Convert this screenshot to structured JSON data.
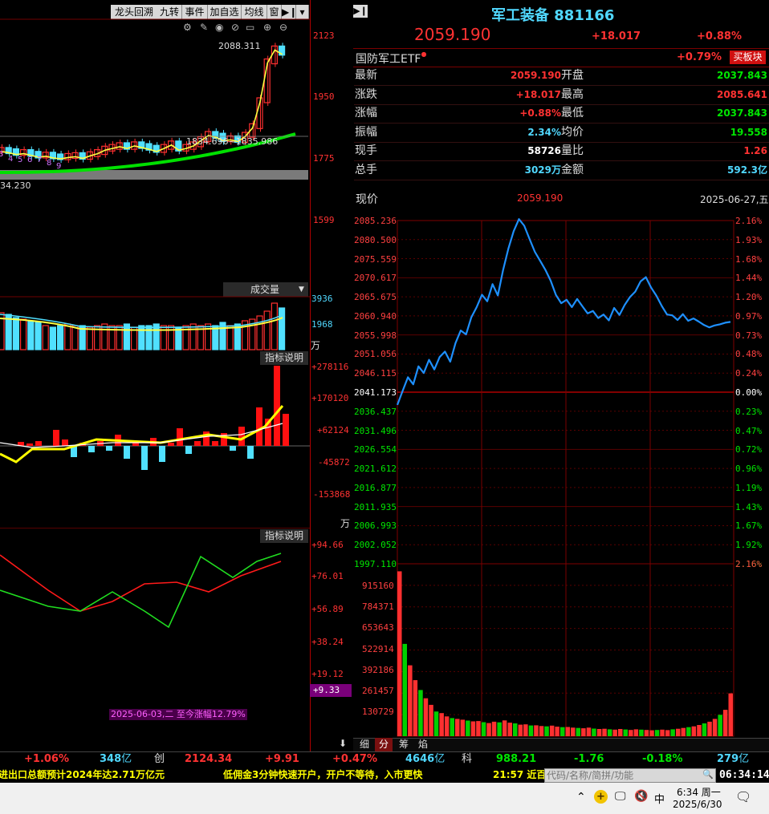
{
  "toolbar_tabs": [
    "龙头回溯",
    "九转",
    "事件",
    "加自选",
    "均线",
    "窗"
  ],
  "kline": {
    "price_ticks": [
      "2123",
      "1950",
      "1775",
      "1599"
    ],
    "high_label": "2088.311",
    "ma_label": "1834.696~1835.986",
    "low_label": "34.230",
    "nine_digits": [
      "3",
      "4",
      "5",
      "6",
      "7",
      "8",
      "9"
    ]
  },
  "volume_panel": {
    "selector": "成交量",
    "ticks": [
      "3936",
      "1968"
    ],
    "unit": "万"
  },
  "macd_panel": {
    "button": "指标说明",
    "ticks": [
      "+278116",
      "+170120",
      "+62124",
      "-45872",
      "-153868"
    ],
    "unit": "万"
  },
  "kdj_panel": {
    "button": "指标说明",
    "ticks": [
      "+94.66",
      "+76.01",
      "+56.89",
      "+38.24",
      "+19.12"
    ],
    "current": "+9.33",
    "footnote": "2025-06-03,二 至今涨幅12.79%"
  },
  "header": {
    "name": "军工装备",
    "code": "881166",
    "price": "2059.190",
    "change": "+18.017",
    "change_pct": "+0.88%"
  },
  "etf": {
    "name": "国防军工ETF",
    "pct": "+0.79%",
    "button": "买板块"
  },
  "stats": [
    {
      "l1": "最新",
      "v1": "2059.190",
      "c1": "red",
      "l2": "开盘",
      "v2": "2037.843",
      "c2": "green"
    },
    {
      "l1": "涨跌",
      "v1": "+18.017",
      "c1": "red",
      "l2": "最高",
      "v2": "2085.641",
      "c2": "red"
    },
    {
      "l1": "涨幅",
      "v1": "+0.88%",
      "c1": "red",
      "l2": "最低",
      "v2": "2037.843",
      "c2": "green"
    },
    {
      "l1": "振幅",
      "v1": "2.34%",
      "c1": "cyan",
      "l2": "均价",
      "v2": "19.558",
      "c2": "green"
    },
    {
      "l1": "现手",
      "v1": "58726",
      "c1": "white",
      "l2": "量比",
      "v2": "1.26",
      "c2": "red"
    },
    {
      "l1": "总手",
      "v1": "3029万",
      "c1": "cyan",
      "l2": "金额",
      "v2": "592.3亿",
      "c2": "cyan"
    }
  ],
  "intraday_header": {
    "label": "现价",
    "price": "2059.190",
    "date": "2025-06-27,五"
  },
  "bottom_tabs": [
    "细",
    "分",
    "筹",
    "焰"
  ],
  "index_bar": {
    "a_pct": "+1.06%",
    "a_amt": "348",
    "a_unit": "亿",
    "chuang_label": "创",
    "chuang_val": "2124.34",
    "chuang_chg": "+9.91",
    "chuang_pct": "+0.47%",
    "chuang_amt": "4646",
    "chuang_unit": "亿",
    "ke_label": "科",
    "ke_val": "988.21",
    "ke_chg": "-1.76",
    "ke_pct": "-0.18%",
    "ke_amt": "279",
    "ke_unit": "亿"
  },
  "ticker": {
    "news1": "进出口总额预计2024年达2.71万亿元",
    "ad": "低佣金3分钟快速开户，开户不等待，入市更快",
    "news2": "21:57 近百",
    "search_placeholder": "代码/名称/简拼/功能",
    "clock": "06:34:14"
  },
  "taskbar": {
    "time": "6:34 周一",
    "date": "2025/6/30",
    "ime": "中"
  },
  "chart_data": {
    "type": "line",
    "title": "",
    "series": [
      {
        "name": "",
        "values": [
          2037.9,
          2041.5,
          2045.0,
          2043.2,
          2047.8,
          2046.1,
          2049.5,
          2047.0,
          2050.2,
          2051.6,
          2049.0,
          2053.8,
          2057.0,
          2056.0,
          2060.4,
          2063.0,
          2066.2,
          2064.5,
          2068.9,
          2066.0,
          2072.5,
          2078.0,
          2082.5,
          2085.6,
          2083.9,
          2080.5,
          2077.2,
          2074.9,
          2072.6,
          2069.8,
          2066.1,
          2064.0,
          2064.9,
          2063.0,
          2065.1,
          2063.2,
          2061.4,
          2062.0,
          2060.2,
          2061.1,
          2059.6,
          2062.8,
          2061.0,
          2063.6,
          2065.6,
          2067.0,
          2069.6,
          2070.7,
          2068.0,
          2065.9,
          2063.3,
          2061.1,
          2060.9,
          2059.7,
          2061.2,
          2059.5,
          2060.1,
          2059.3,
          2058.4,
          2057.8,
          2058.3,
          2058.6,
          2059.0,
          2059.2
        ]
      }
    ],
    "ylim": [
      1997.11,
      2085.236
    ],
    "y_ticks": [
      "2085.236",
      "2080.500",
      "2075.559",
      "2070.617",
      "2065.675",
      "2060.940",
      "2055.998",
      "2051.056",
      "2046.115",
      "2041.173",
      "2036.437",
      "2031.496",
      "2026.554",
      "2021.612",
      "2016.877",
      "2011.935",
      "2006.993",
      "2002.052",
      "1997.110"
    ],
    "pct_ticks": [
      "2.16%",
      "1.93%",
      "1.68%",
      "1.44%",
      "1.20%",
      "0.97%",
      "0.73%",
      "0.48%",
      "0.24%",
      "0.00%",
      "0.23%",
      "0.47%",
      "0.72%",
      "0.96%",
      "1.19%",
      "1.43%",
      "1.67%",
      "1.92%",
      "2.16%"
    ],
    "volume": {
      "ticks": [
        "915160",
        "784371",
        "653643",
        "522914",
        "392186",
        "261457",
        "130729"
      ],
      "ylim": [
        0,
        1045889
      ],
      "values": [
        1000000,
        560000,
        430000,
        340000,
        280000,
        230000,
        190000,
        150000,
        140000,
        120000,
        110000,
        105000,
        100000,
        95000,
        90000,
        92000,
        85000,
        80000,
        88000,
        84000,
        96000,
        82000,
        78000,
        70000,
        72000,
        65000,
        66000,
        62000,
        60000,
        64000,
        58000,
        55000,
        56000,
        52000,
        50000,
        48000,
        52000,
        46000,
        44000,
        45000,
        42000,
        40000,
        44000,
        41000,
        38000,
        42000,
        40000,
        38000,
        36000,
        38000,
        40000,
        37000,
        42000,
        45000,
        50000,
        55000,
        60000,
        68000,
        78000,
        88000,
        105000,
        130000,
        160000,
        260000
      ]
    }
  }
}
